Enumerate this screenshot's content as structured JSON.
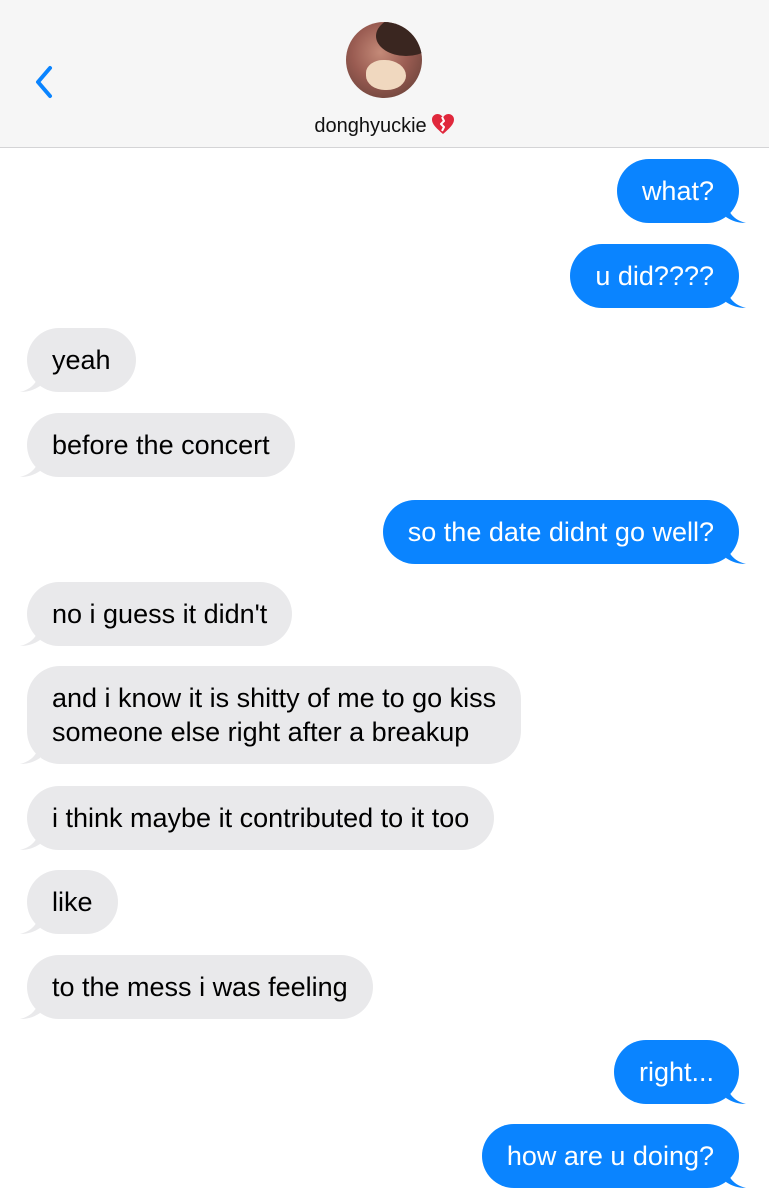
{
  "header": {
    "contact_name": "donghyuckie",
    "back_icon": "chevron-left-icon",
    "heart_icon": "mending-heart-emoji"
  },
  "colors": {
    "sent_bubble": "#0a84ff",
    "received_bubble": "#e9e9eb",
    "header_bg": "#f6f6f6",
    "back_arrow": "#0a84ff"
  },
  "messages": [
    {
      "from": "me",
      "text": "what?"
    },
    {
      "from": "me",
      "text": "u did????"
    },
    {
      "from": "them",
      "text": "yeah"
    },
    {
      "from": "them",
      "text": "before the concert"
    },
    {
      "from": "me",
      "text": "so the date didnt go well?"
    },
    {
      "from": "them",
      "text": "no i guess it didn't"
    },
    {
      "from": "them",
      "lines": [
        "and i know it is shitty of me to go kiss",
        "someone else right after a breakup"
      ]
    },
    {
      "from": "them",
      "text": "i think maybe it contributed to it too"
    },
    {
      "from": "them",
      "text": "like"
    },
    {
      "from": "them",
      "text": "to the mess i was feeling"
    },
    {
      "from": "me",
      "text": "right..."
    },
    {
      "from": "me",
      "text": "how are u doing?"
    }
  ]
}
